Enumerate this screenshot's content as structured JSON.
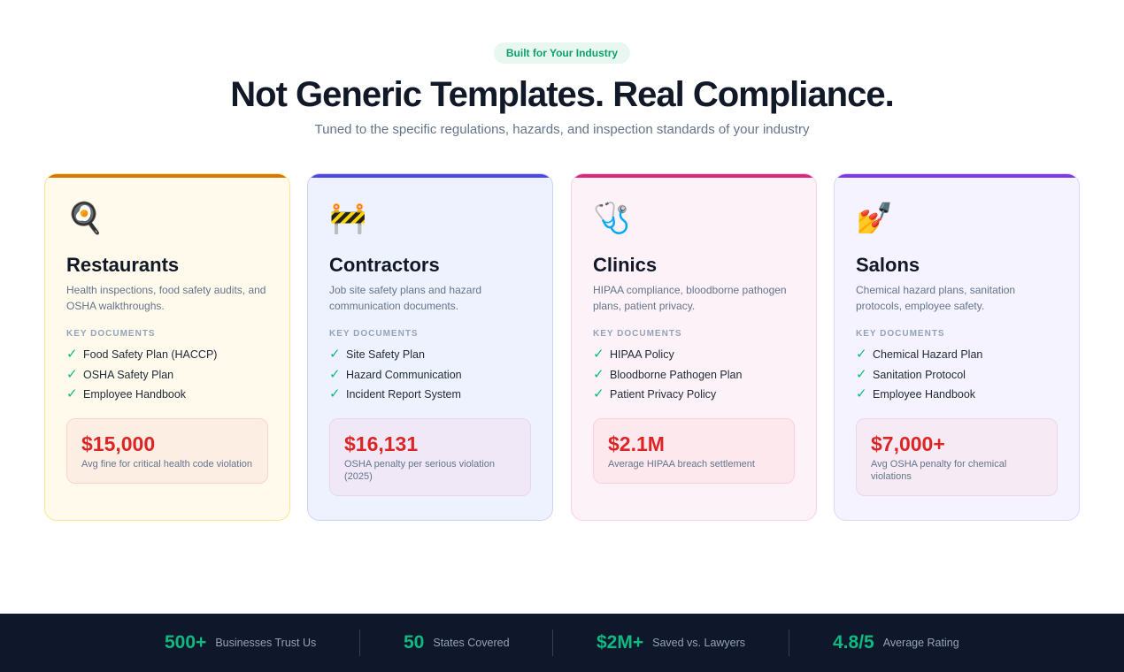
{
  "hero": {
    "badge": "Built for Your Industry",
    "headline": "Not Generic Templates. Real Compliance.",
    "subhead": "Tuned to the specific regulations, hazards, and inspection standards of your industry"
  },
  "key_documents_label": "KEY DOCUMENTS",
  "cards": [
    {
      "icon": "🍳",
      "icon_name": "frying-pan-icon",
      "title": "Restaurants",
      "description": "Health inspections, food safety audits, and OSHA walkthroughs.",
      "documents": [
        "Food Safety Plan (HACCP)",
        "OSHA Safety Plan",
        "Employee Handbook"
      ],
      "stat_amount": "$15,000",
      "stat_label": "Avg fine for critical health code violation",
      "accent": "#d97706"
    },
    {
      "icon": "🚧",
      "icon_name": "construction-barrier-icon",
      "title": "Contractors",
      "description": "Job site safety plans and hazard communication documents.",
      "documents": [
        "Site Safety Plan",
        "Hazard Communication",
        "Incident Report System"
      ],
      "stat_amount": "$16,131",
      "stat_label": "OSHA penalty per serious violation (2025)",
      "accent": "#4f46e5"
    },
    {
      "icon": "🩺",
      "icon_name": "stethoscope-icon",
      "title": "Clinics",
      "description": "HIPAA compliance, bloodborne pathogen plans, patient privacy.",
      "documents": [
        "HIPAA Policy",
        "Bloodborne Pathogen Plan",
        "Patient Privacy Policy"
      ],
      "stat_amount": "$2.1M",
      "stat_label": "Average HIPAA breach settlement",
      "accent": "#db2777"
    },
    {
      "icon": "💅",
      "icon_name": "nail-polish-icon",
      "title": "Salons",
      "description": "Chemical hazard plans, sanitation protocols, employee safety.",
      "documents": [
        "Chemical Hazard Plan",
        "Sanitation Protocol",
        "Employee Handbook"
      ],
      "stat_amount": "$7,000+",
      "stat_label": "Avg OSHA penalty for chemical violations",
      "accent": "#7c3aed"
    }
  ],
  "check_glyph": "✓",
  "footer": {
    "stats": [
      {
        "value": "500+",
        "label": "Businesses Trust Us"
      },
      {
        "value": "50",
        "label": "States Covered"
      },
      {
        "value": "$2M+",
        "label": "Saved vs. Lawyers"
      },
      {
        "value": "4.8/5",
        "label": "Average Rating"
      }
    ]
  },
  "colors": {
    "accent_green": "#10b981",
    "stat_red": "#dc2626",
    "footer_bg": "#0f172a"
  }
}
